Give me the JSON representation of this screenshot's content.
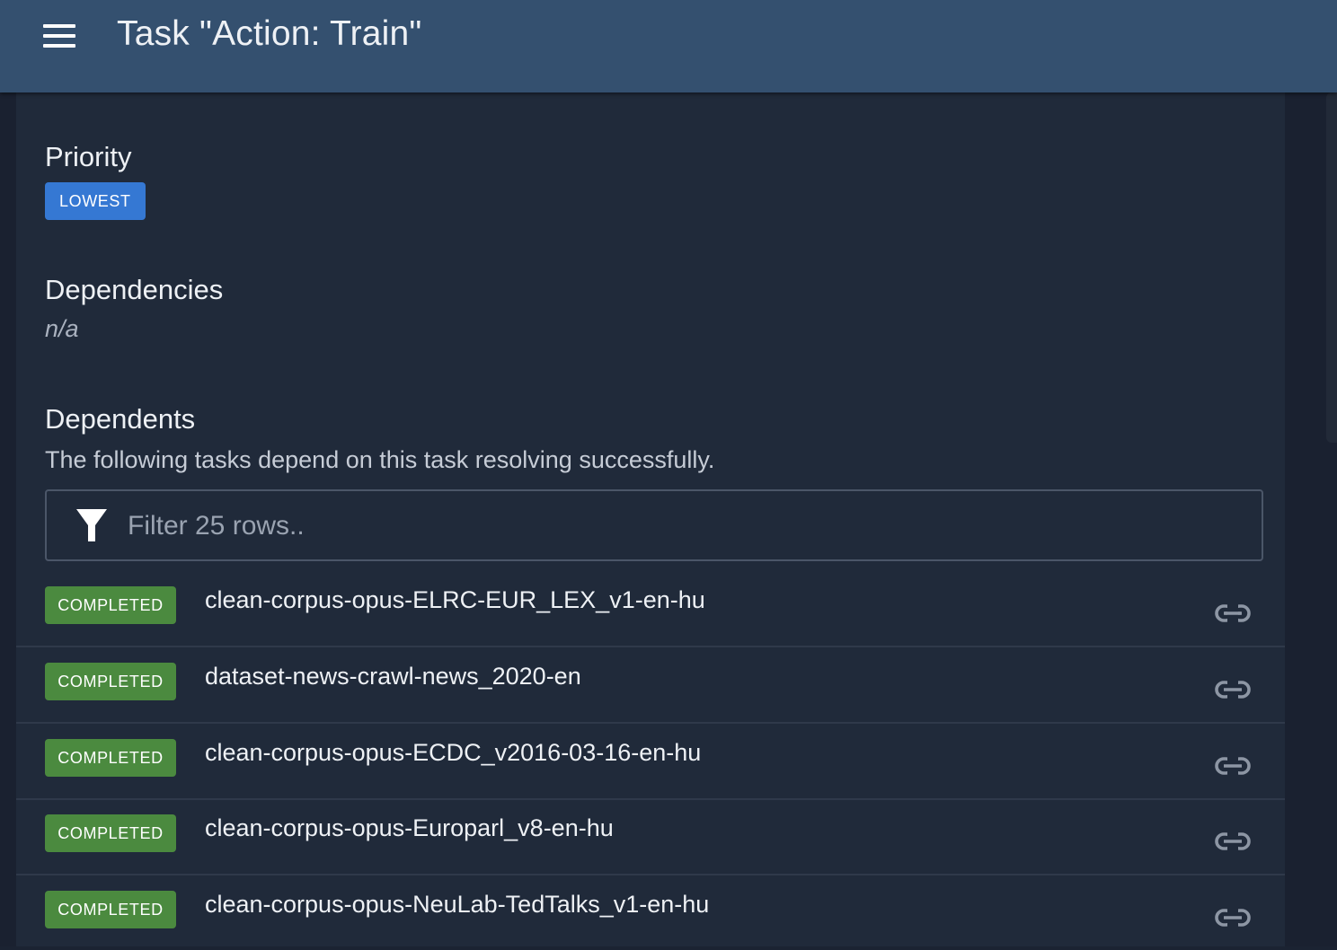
{
  "header": {
    "title": "Task \"Action: Train\""
  },
  "priority": {
    "heading": "Priority",
    "value": "LOWEST"
  },
  "dependencies": {
    "heading": "Dependencies",
    "value": "n/a"
  },
  "dependents": {
    "heading": "Dependents",
    "description": "The following tasks depend on this task resolving successfully.",
    "filter_placeholder": "Filter 25 rows..",
    "rows": [
      {
        "status": "COMPLETED",
        "name": "clean-corpus-opus-ELRC-EUR_LEX_v1-en-hu"
      },
      {
        "status": "COMPLETED",
        "name": "dataset-news-crawl-news_2020-en"
      },
      {
        "status": "COMPLETED",
        "name": "clean-corpus-opus-ECDC_v2016-03-16-en-hu"
      },
      {
        "status": "COMPLETED",
        "name": "clean-corpus-opus-Europarl_v8-en-hu"
      },
      {
        "status": "COMPLETED",
        "name": "clean-corpus-opus-NeuLab-TedTalks_v1-en-hu"
      }
    ]
  },
  "colors": {
    "appbar": "#34506f",
    "card": "#202a3a",
    "priority_chip": "#3578d3",
    "completed_chip": "#4b8a3f"
  },
  "icons": {
    "menu": "menu-icon",
    "filter": "filter-icon",
    "link": "link-icon"
  }
}
